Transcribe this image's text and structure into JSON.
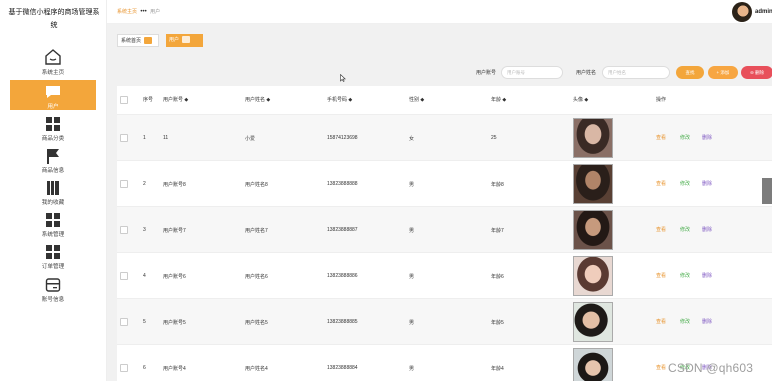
{
  "app": {
    "title": "基于微信小程序的商场管理系统"
  },
  "sidebar": {
    "items": [
      {
        "label": "系统主页",
        "icon": "home-icon",
        "active": false
      },
      {
        "label": "用户",
        "icon": "chat-icon",
        "active": true
      },
      {
        "label": "商品分类",
        "icon": "grid-icon",
        "active": false
      },
      {
        "label": "商品信息",
        "icon": "flag-icon",
        "active": false
      },
      {
        "label": "我的收藏",
        "icon": "bookmark-icon",
        "active": false
      },
      {
        "label": "系统管理",
        "icon": "grid-icon",
        "active": false
      },
      {
        "label": "订单管理",
        "icon": "grid-icon",
        "active": false
      },
      {
        "label": "账号信息",
        "icon": "id-card-icon",
        "active": false
      }
    ]
  },
  "header": {
    "breadcrumb": {
      "home": "系统主页",
      "separator": "•••",
      "current": "用户"
    },
    "user": {
      "name": "admin"
    }
  },
  "tabs": [
    {
      "label": "系统首页"
    },
    {
      "label": "用户"
    }
  ],
  "search": {
    "account_label": "用户账号",
    "account_placeholder": "用户账号",
    "name_label": "用户姓名",
    "name_placeholder": "用户姓名",
    "search_btn": "查找",
    "add_btn": "+ 添加",
    "delete_btn": "⊖ 删除"
  },
  "table": {
    "headers": {
      "index": "序号",
      "account": "用户账号 ◆",
      "name": "用户姓名 ◆",
      "phone": "手机号码 ◆",
      "gender": "性别 ◆",
      "age": "年龄 ◆",
      "avatar": "头像 ◆",
      "actions": "操作"
    },
    "rows": [
      {
        "index": "1",
        "account": "11",
        "name": "小爱",
        "phone": "15874123698",
        "gender": "女",
        "age": "25"
      },
      {
        "index": "2",
        "account": "用户账号8",
        "name": "用户姓名8",
        "phone": "13823888888",
        "gender": "男",
        "age": "年龄8"
      },
      {
        "index": "3",
        "account": "用户账号7",
        "name": "用户姓名7",
        "phone": "13823888887",
        "gender": "男",
        "age": "年龄7"
      },
      {
        "index": "4",
        "account": "用户账号6",
        "name": "用户姓名6",
        "phone": "13823888886",
        "gender": "男",
        "age": "年龄6"
      },
      {
        "index": "5",
        "account": "用户账号5",
        "name": "用户姓名5",
        "phone": "13823888885",
        "gender": "男",
        "age": "年龄5"
      },
      {
        "index": "6",
        "account": "用户账号4",
        "name": "用户姓名4",
        "phone": "13823888884",
        "gender": "男",
        "age": "年龄4"
      }
    ],
    "actions": {
      "view": "查看",
      "edit": "修改",
      "delete": "删除"
    }
  },
  "watermark": "CSDN @qh603",
  "colors": {
    "accent": "#f3a63b",
    "add": "#f7a642",
    "delete": "#e8505b",
    "view": "#e8932c",
    "edit": "#4caf50",
    "del": "#7e57c2"
  }
}
